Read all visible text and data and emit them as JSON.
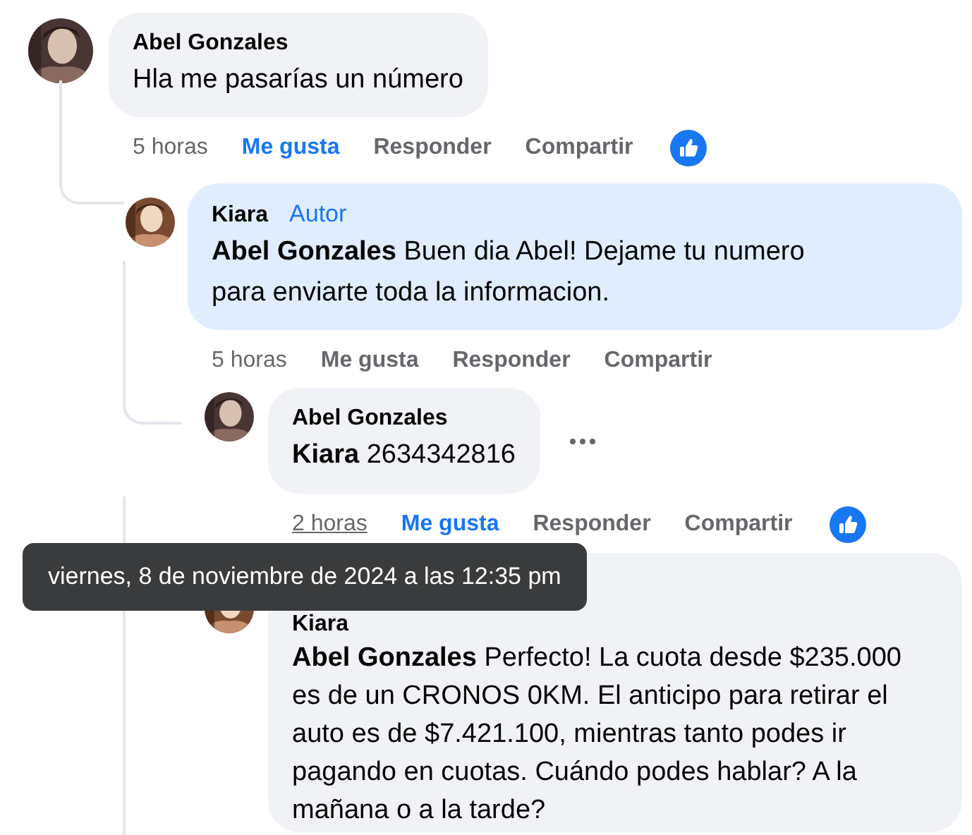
{
  "comments": [
    {
      "author": "Abel Gonzales",
      "text": "Hla me pasarías un número",
      "avatar": {
        "kind": "picture"
      },
      "time": "5 horas",
      "time_hovered": false,
      "like_label": "Me gusta",
      "liked": true,
      "reply_label": "Responder",
      "share_label": "Compartir",
      "has_reaction": true,
      "replies": [
        {
          "author": "Kiara",
          "badge": "Autor",
          "mention": "Abel Gonzales",
          "text": "Buen dia Abel! Dejame tu numero para enviarte toda la informacion.",
          "avatar": {
            "kind": "picture"
          },
          "highlighted": true,
          "time": "5 horas",
          "time_hovered": false,
          "like_label": "Me gusta",
          "liked": false,
          "reply_label": "Responder",
          "share_label": "Compartir",
          "has_reaction": false,
          "replies": [
            {
              "author": "Abel Gonzales",
              "mention": "Kiara",
              "text": "2634342816",
              "avatar": {
                "kind": "picture"
              },
              "highlighted": false,
              "menu_visible": true,
              "time": "2 horas",
              "time_hovered": true,
              "like_label": "Me gusta",
              "liked": true,
              "reply_label": "Responder",
              "share_label": "Compartir",
              "has_reaction": true
            },
            {
              "author": "Kiara",
              "mention": "Abel Gonzales",
              "text": "Perfecto! La cuota desde $235.000 es de un CRONOS 0KM. El anticipo para retirar el auto es de $7.421.100, mientras tanto podes ir pagando en cuotas. Cuándo podes hablar? A la mañana o a la tarde?",
              "avatar": {
                "kind": "picture"
              },
              "highlighted": false
            }
          ]
        }
      ]
    }
  ],
  "tooltip": "viernes, 8 de noviembre de 2024 a las 12:35 pm"
}
